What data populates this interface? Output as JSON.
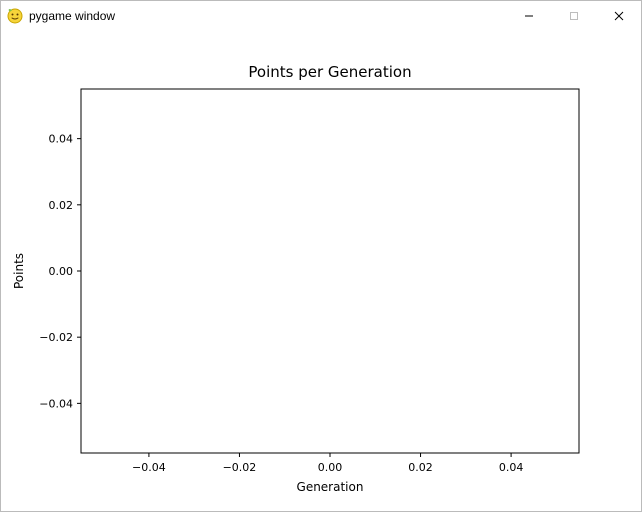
{
  "window": {
    "title": "pygame window"
  },
  "controls": {
    "minimize": "—",
    "maximize": "□",
    "close": "✕"
  },
  "chart_data": {
    "type": "scatter",
    "title": "Points per Generation",
    "xlabel": "Generation",
    "ylabel": "Points",
    "xlim": [
      -0.055,
      0.055
    ],
    "ylim": [
      -0.055,
      0.055
    ],
    "xticks": [
      -0.04,
      -0.02,
      0.0,
      0.02,
      0.04
    ],
    "yticks": [
      -0.04,
      -0.02,
      0.0,
      0.02,
      0.04
    ],
    "xtick_labels": [
      "−0.04",
      "−0.02",
      "0.00",
      "0.02",
      "0.04"
    ],
    "ytick_labels": [
      "−0.04",
      "−0.02",
      "0.00",
      "0.02",
      "0.04"
    ],
    "x": [],
    "y": []
  }
}
